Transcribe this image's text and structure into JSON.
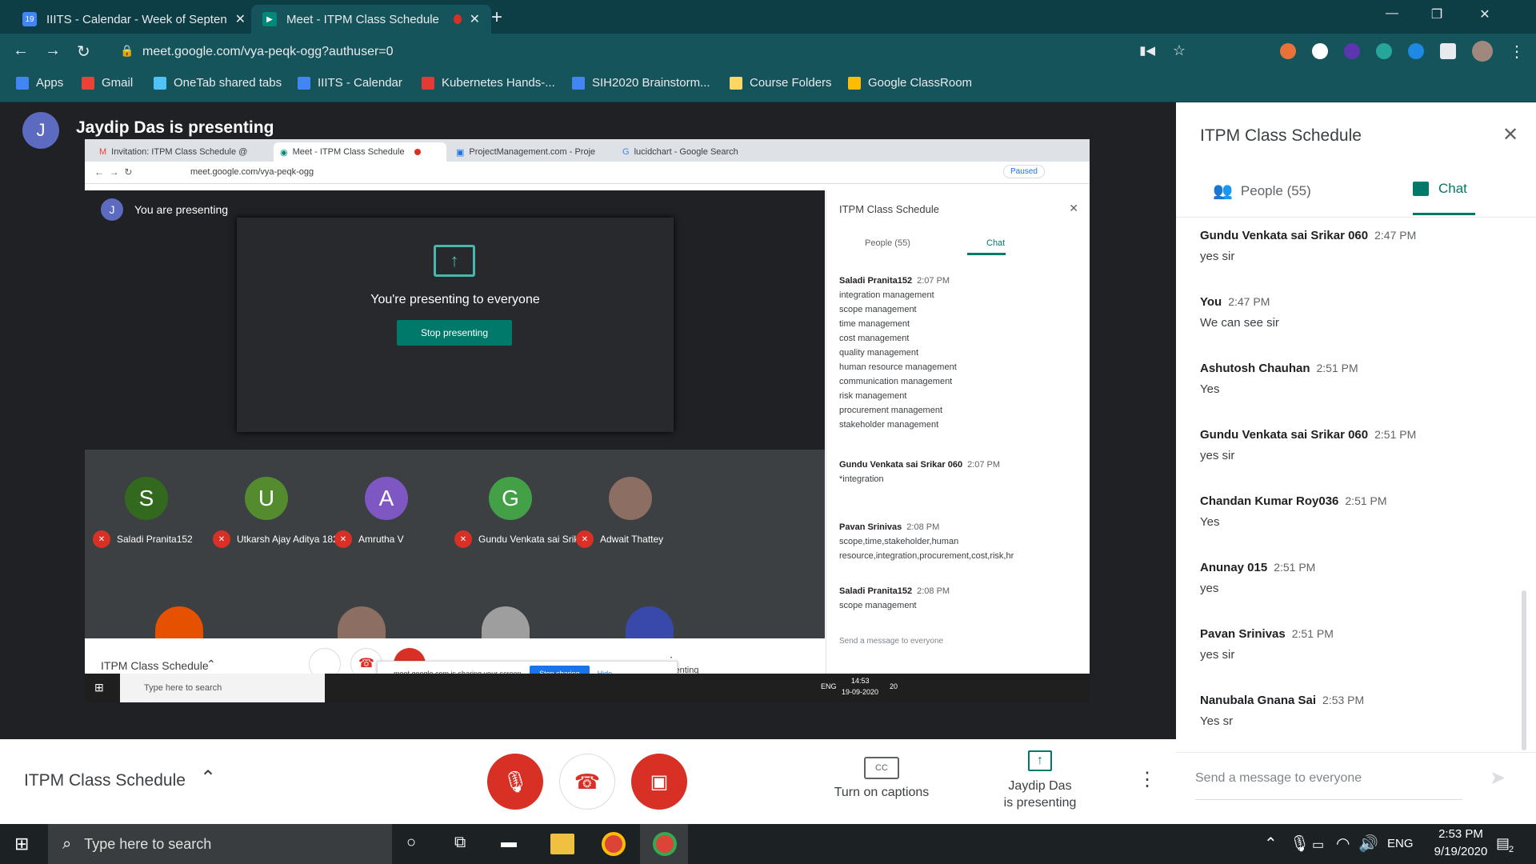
{
  "browser": {
    "tabs": [
      {
        "label": "IIITS - Calendar - Week of Septen",
        "icon": "calendar-icon"
      },
      {
        "label": "Meet - ITPM Class Schedule",
        "icon": "meet-icon"
      }
    ],
    "new_tab": "+",
    "url": "meet.google.com/vya-peqk-ogg?authuser=0",
    "bookmarks": [
      {
        "label": "Apps",
        "icon": "apps-grid-icon"
      },
      {
        "label": "Gmail",
        "icon": "gmail-icon"
      },
      {
        "label": "OneTab shared tabs",
        "icon": "onetab-icon"
      },
      {
        "label": "IIITS - Calendar",
        "icon": "calendar-icon"
      },
      {
        "label": "Kubernetes Hands-...",
        "icon": "kubernetes-icon"
      },
      {
        "label": "SIH2020 Brainstorm...",
        "icon": "docs-icon"
      },
      {
        "label": "Course Folders",
        "icon": "folder-icon"
      },
      {
        "label": "Google ClassRoom",
        "icon": "classroom-icon"
      }
    ]
  },
  "meet": {
    "presenter_avatar": "J",
    "presenter_text": "Jaydip Das is presenting",
    "meeting_title": "ITPM Class Schedule",
    "captions_label": "Turn on captions",
    "presenting_label_1": "Jaydip Das",
    "presenting_label_2": "is presenting",
    "colors": {
      "accent": "#00796b",
      "danger": "#d93025",
      "teal_bar": "#16545c"
    }
  },
  "shared_screen": {
    "tabs": [
      {
        "label": "Invitation: ITPM Class Schedule @"
      },
      {
        "label": "Meet - ITPM Class Schedule"
      },
      {
        "label": "ProjectManagement.com - Proje"
      },
      {
        "label": "lucidchart - Google Search"
      }
    ],
    "url": "meet.google.com/vya-peqk-ogg",
    "paused_label": "Paused",
    "you_presenting": "You are presenting",
    "presenting_everyone": "You're presenting to everyone",
    "stop_presenting": "Stop presenting",
    "participants": [
      {
        "initial": "S",
        "name": "Saladi Pranita152",
        "color": "#33691e"
      },
      {
        "initial": "U",
        "name": "Utkarsh Ajay Aditya 182",
        "color": "#558b2f"
      },
      {
        "initial": "A",
        "name": "Amrutha V",
        "color": "#7e57c2"
      },
      {
        "initial": "G",
        "name": "Gundu Venkata sai Srik...",
        "color": "#43a047"
      },
      {
        "initial": "",
        "name": "Adwait Thattey",
        "color": "#8d6e63"
      }
    ],
    "bottom_title": "ITPM Class Schedule",
    "sharing_notice": "meet.google.com is sharing your screen.",
    "stop_sharing": "Stop sharing",
    "hide": "Hide",
    "presenting_partial": "senting",
    "panel_title": "ITPM Class Schedule",
    "people_tab": "People (55)",
    "chat_tab": "Chat",
    "messages": [
      {
        "name": "Saladi Pranita152",
        "time": "2:07 PM",
        "lines": [
          "integration management",
          "scope management",
          "time management",
          "cost management",
          "quality management",
          "human resource management",
          "communication management",
          "risk management",
          "procurement management",
          "stakeholder management"
        ]
      },
      {
        "name": "Gundu Venkata sai Srikar 060",
        "time": "2:07 PM",
        "lines": [
          "*integration"
        ]
      },
      {
        "name": "Pavan Srinivas",
        "time": "2:08 PM",
        "lines": [
          "scope,time,stakeholder,human",
          "resource,integration,procurement,cost,risk,hr"
        ]
      },
      {
        "name": "Saladi Pranita152",
        "time": "2:08 PM",
        "lines": [
          "scope management"
        ]
      }
    ],
    "send_placeholder": "Send a message to everyone",
    "taskbar_search": "Type here to search",
    "lang": "ENG",
    "time": "14:53",
    "date": "19-09-2020",
    "notif": "20"
  },
  "panel": {
    "title": "ITPM Class Schedule",
    "people_tab": "People (55)",
    "chat_tab": "Chat",
    "messages": [
      {
        "name": "Gundu Venkata sai Srikar 060",
        "time": "2:47 PM",
        "text": "yes sir"
      },
      {
        "name": "You",
        "time": "2:47 PM",
        "text": "We can see sir"
      },
      {
        "name": "Ashutosh Chauhan",
        "time": "2:51 PM",
        "text": "Yes"
      },
      {
        "name": "Gundu Venkata sai Srikar 060",
        "time": "2:51 PM",
        "text": "yes sir"
      },
      {
        "name": "Chandan Kumar Roy036",
        "time": "2:51 PM",
        "text": "Yes"
      },
      {
        "name": "Anunay 015",
        "time": "2:51 PM",
        "text": "yes"
      },
      {
        "name": "Pavan Srinivas",
        "time": "2:51 PM",
        "text": "yes sir"
      },
      {
        "name": "Nanubala Gnana Sai",
        "time": "2:53 PM",
        "text": "Yes sr"
      }
    ],
    "send_placeholder": "Send a message to everyone"
  },
  "taskbar": {
    "search_placeholder": "Type here to search",
    "lang": "ENG",
    "time": "2:53 PM",
    "date": "9/19/2020",
    "notif": "2"
  }
}
